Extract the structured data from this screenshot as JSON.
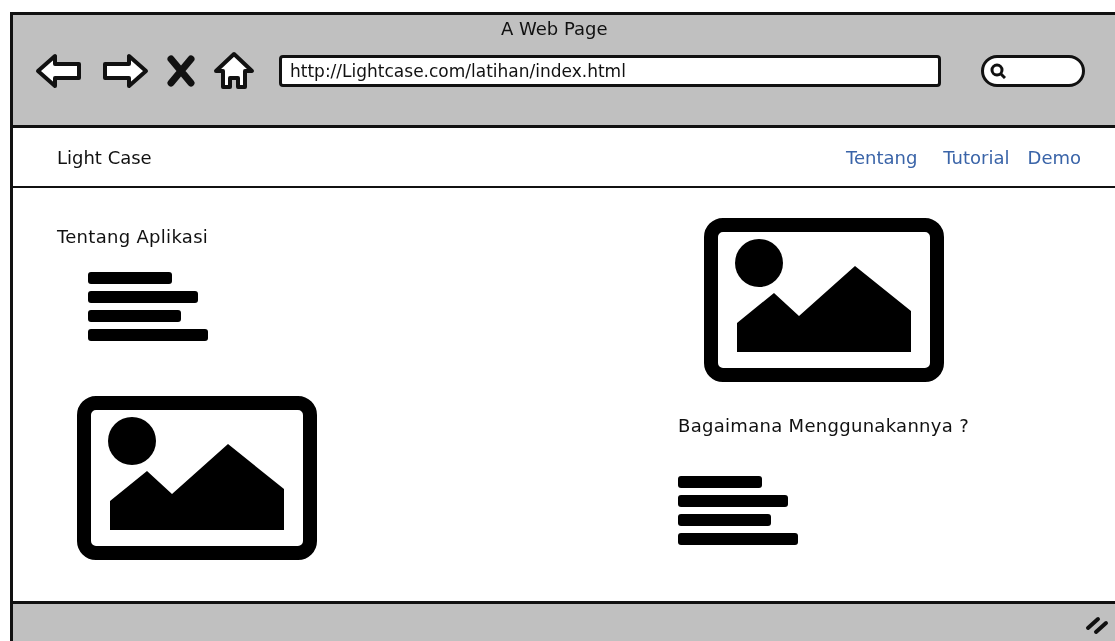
{
  "window": {
    "title": "A Web Page"
  },
  "address_bar": {
    "url": "http://Lightcase.com/latihan/index.html"
  },
  "navbar": {
    "brand": "Light Case",
    "links": [
      {
        "label": "Tentang"
      },
      {
        "label": "Tutorial"
      },
      {
        "label": "Demo"
      }
    ]
  },
  "columns": [
    {
      "blocks": [
        {
          "kind": "heading",
          "text": "Tentang Aplikasi"
        },
        {
          "kind": "lines"
        },
        {
          "kind": "image"
        }
      ]
    },
    {
      "blocks": [
        {
          "kind": "image"
        },
        {
          "kind": "heading",
          "text": "Bagaimana Menggunakannya ?"
        },
        {
          "kind": "lines"
        }
      ]
    }
  ]
}
